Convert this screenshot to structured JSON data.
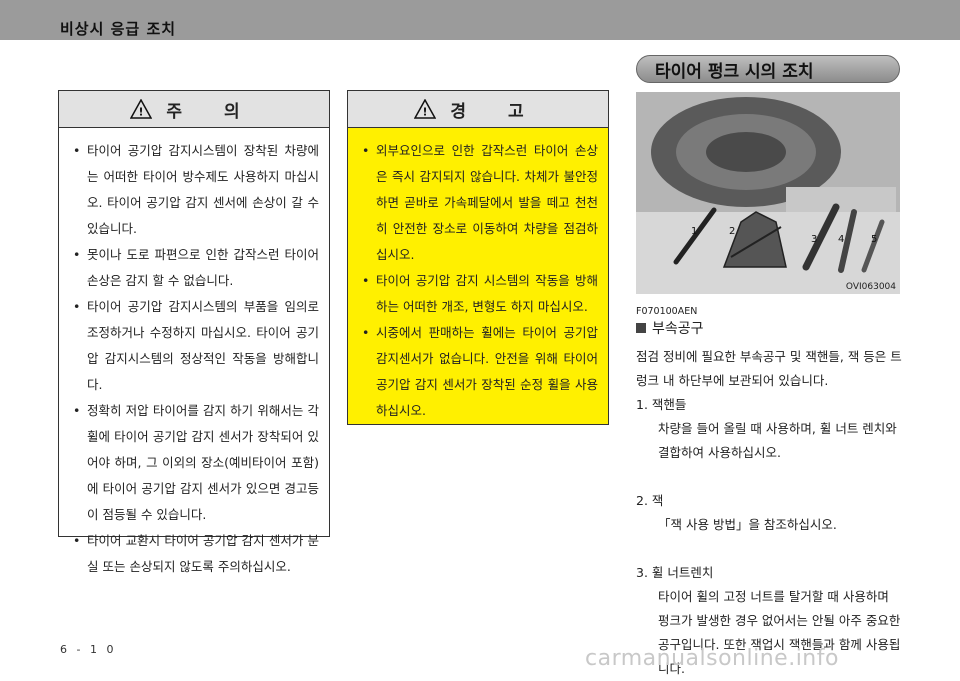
{
  "header": {
    "title": "비상시 응급 조치"
  },
  "caution": {
    "title": "주 의",
    "items": [
      "타이어 공기압 감지시스템이 장착된 차량에는 어떠한 타이어 방수제도 사용하지 마십시오. 타이어 공기압 감지 센서에 손상이 갈 수 있습니다.",
      "못이나 도로 파편으로 인한 갑작스런 타이어 손상은 감지 할 수 없습니다.",
      "타이어 공기압 감지시스템의 부품을 임의로 조정하거나 수정하지 마십시오. 타이어 공기압 감지시스템의 정상적인 작동을 방해합니다.",
      "정확히 저압 타이어를 감지 하기 위해서는 각 휠에 타이어 공기압 감지 센서가 장착되어 있어야 하며, 그 이외의 장소(예비타이어 포함)에 타이어 공기압 감지 센서가 있으면 경고등이 점등될 수 있습니다.",
      "타이어 교환시 타이어 공기압 감지 센서가 분실 또는 손상되지 않도록 주의하십시오."
    ]
  },
  "warning": {
    "title": "경 고",
    "items": [
      "외부요인으로 인한 갑작스런 타이어 손상은 즉시 감지되지 않습니다. 차체가 불안정하면 곧바로 가속페달에서 발을 떼고 천천히 안전한 장소로 이동하여 차량을 점검하십시오.",
      "타이어 공기압 감지 시스템의 작동을 방해하는 어떠한 개조, 변형도 하지 마십시오.",
      "시중에서 판매하는 휠에는 타이어 공기압 감지센서가 없습니다. 안전을 위해 타이어 공기압 감지 센서가 장착된 순정 휠을 사용하십시오."
    ]
  },
  "section": {
    "title": "타이어 펑크 시의 조치"
  },
  "photo": {
    "code": "OVI063004",
    "labels": [
      "1",
      "2",
      "3",
      "4",
      "5"
    ]
  },
  "doc_id": "F070100AEN",
  "subsection": {
    "title": "부속공구"
  },
  "intro": "점검 정비에 필요한 부속공구 및 잭핸들, 잭 등은 트렁크 내 하단부에 보관되어 있습니다.",
  "tools": [
    {
      "num": "1.",
      "name": "잭핸들",
      "desc": "차량을 들어 올릴 때 사용하며, 휠 너트 렌치와 결합하여 사용하십시오."
    },
    {
      "num": "2.",
      "name": "잭",
      "desc": "「잭 사용 방법」을 참조하십시오."
    },
    {
      "num": "3.",
      "name": "휠 너트렌치",
      "desc": "타이어 휠의 고정 너트를 탈거할 때 사용하며 펑크가 발생한 경우 없어서는 안될 아주 중요한 공구입니다. 또한 잭업시 잭핸들과 함께 사용됩니다."
    }
  ],
  "footer": {
    "page": "6 - 1 0",
    "watermark": "carmanualsonline.info"
  }
}
